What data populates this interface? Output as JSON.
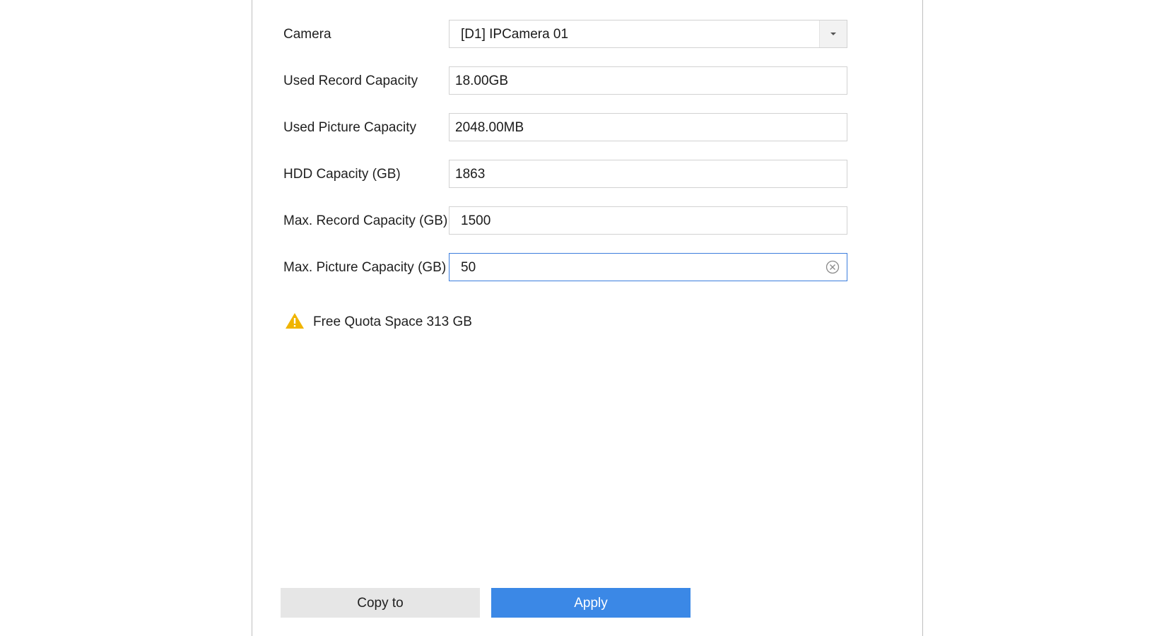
{
  "form": {
    "camera": {
      "label": "Camera",
      "value": "[D1] IPCamera 01"
    },
    "used_record_capacity": {
      "label": "Used Record Capacity",
      "value": "18.00GB"
    },
    "used_picture_capacity": {
      "label": "Used Picture Capacity",
      "value": "2048.00MB"
    },
    "hdd_capacity": {
      "label": "HDD Capacity (GB)",
      "value": "1863"
    },
    "max_record_capacity": {
      "label": "Max. Record Capacity (GB)",
      "value": "1500"
    },
    "max_picture_capacity": {
      "label": "Max. Picture Capacity (GB)",
      "value": "50"
    }
  },
  "notice": {
    "text": "Free Quota Space 313 GB",
    "icon": "warning-icon",
    "icon_color": "#f0b400"
  },
  "buttons": {
    "copy_to": "Copy to",
    "apply": "Apply"
  },
  "colors": {
    "accent": "#3b88e6",
    "focus_border": "#3b7ddd"
  }
}
